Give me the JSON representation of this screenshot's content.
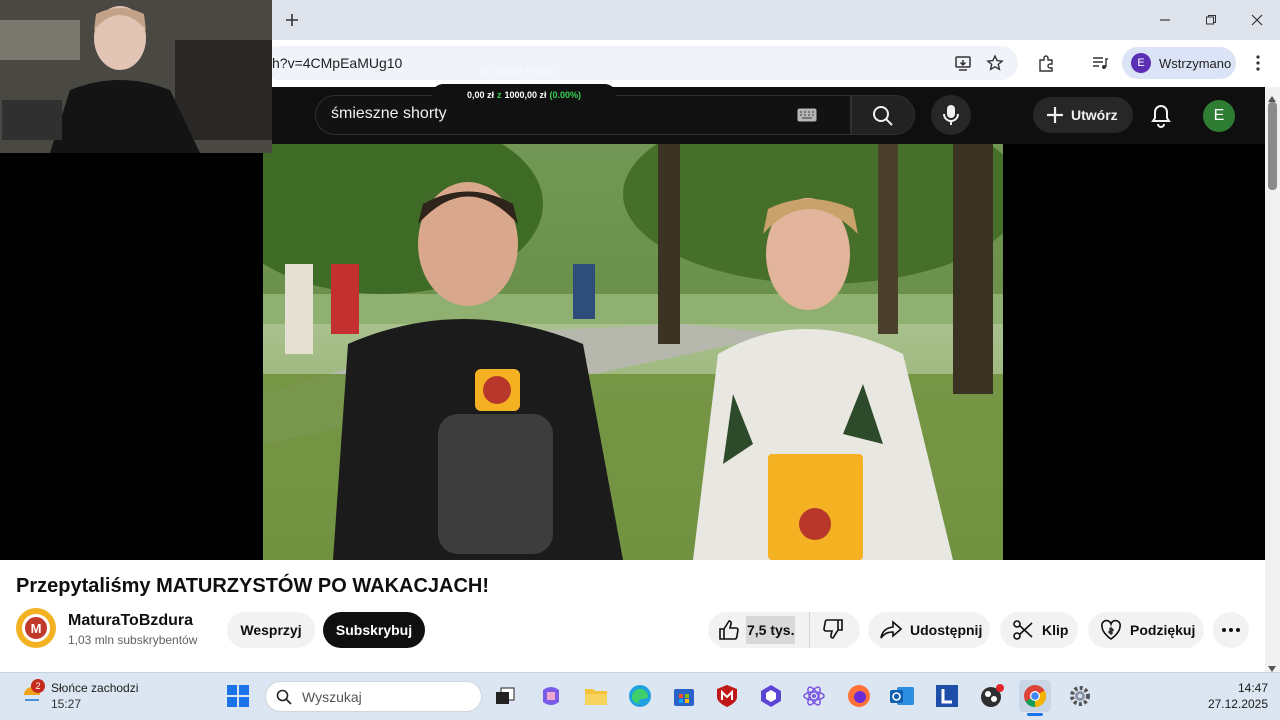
{
  "browser": {
    "new_tab_icon": "plus-icon",
    "url_fragment": "h?v=4CMpEaMUg10",
    "profile_initial": "E",
    "profile_status": "Wstrzymano"
  },
  "overlay": {
    "donation_faint": "na ruchy Pando",
    "donation_left": "0,00 zł",
    "donation_z": "z",
    "donation_target": "1000,00 zł",
    "donation_pct": "(0.00%)"
  },
  "youtube": {
    "search_query": "śmieszne shorty",
    "create_label": "Utwórz",
    "user_initial": "E",
    "video_title": "Przepytaliśmy MATURZYSTÓW PO WAKACJACH!",
    "channel_name": "MaturaToBzdura",
    "subscribers": "1,03 mln subskrybentów",
    "support_label": "Wesprzyj",
    "subscribe_label": "Subskrybuj",
    "likes": "7,5 tys.",
    "share_label": "Udostępnij",
    "clip_label": "Klip",
    "thanks_label": "Podziękuj",
    "logo_letter": "M"
  },
  "taskbar": {
    "weather_badge": "2",
    "weather_title": "Słońce zachodzi",
    "weather_time": "15:27",
    "search_placeholder": "Wyszukaj",
    "time": "14:47",
    "date": "27.12.2025",
    "apps": [
      "windows-start-icon",
      "task-view-icon",
      "copilot-icon",
      "file-explorer-icon",
      "edge-icon",
      "store-icon",
      "mcafee-icon",
      "vpn-icon",
      "react-icon",
      "firefox-icon",
      "outlook-icon",
      "l-app-icon",
      "obs-icon",
      "chrome-icon",
      "settings-icon"
    ]
  },
  "colors": {
    "yt_dark": "#0f0f0f",
    "accent_orange": "#f4b223",
    "avatar_green": "#2e7d32",
    "profile_purple": "#5b2fb5"
  }
}
